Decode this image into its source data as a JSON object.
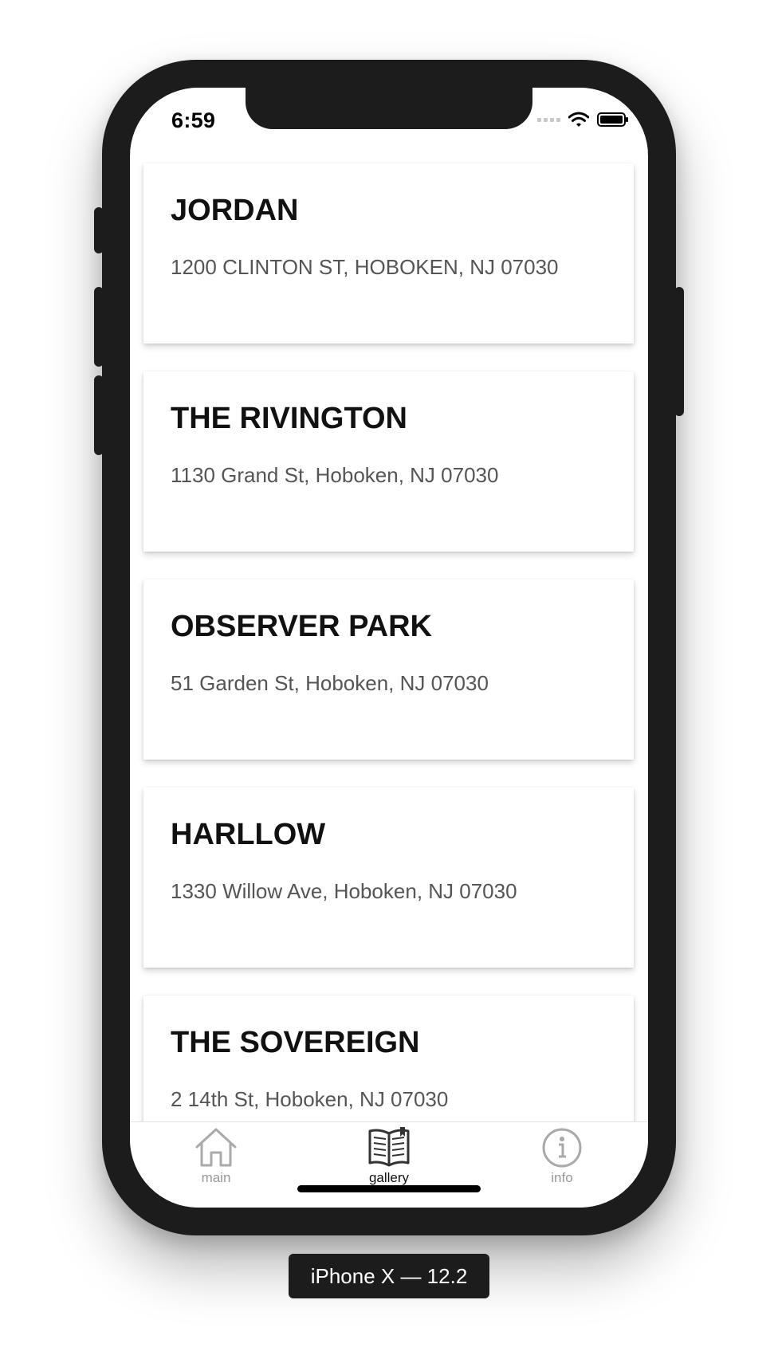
{
  "status_bar": {
    "time": "6:59"
  },
  "cards": [
    {
      "name": "JORDAN",
      "address": "1200 CLINTON ST, HOBOKEN, NJ 07030"
    },
    {
      "name": "THE RIVINGTON",
      "address": "1130 Grand St, Hoboken, NJ 07030"
    },
    {
      "name": "OBSERVER PARK",
      "address": "51 Garden St, Hoboken, NJ 07030"
    },
    {
      "name": "HARLLOW",
      "address": "1330 Willow Ave, Hoboken, NJ 07030"
    },
    {
      "name": "THE SOVEREIGN",
      "address": "2 14th St, Hoboken, NJ 07030"
    }
  ],
  "tabs": [
    {
      "label": "main",
      "icon": "home-icon",
      "active": false
    },
    {
      "label": "gallery",
      "icon": "book-icon",
      "active": true
    },
    {
      "label": "info",
      "icon": "info-icon",
      "active": false
    }
  ],
  "device_label": "iPhone X — 12.2",
  "colors": {
    "active_tab": "#111111",
    "inactive_tab": "#999999",
    "device_frame": "#1c1c1c"
  }
}
